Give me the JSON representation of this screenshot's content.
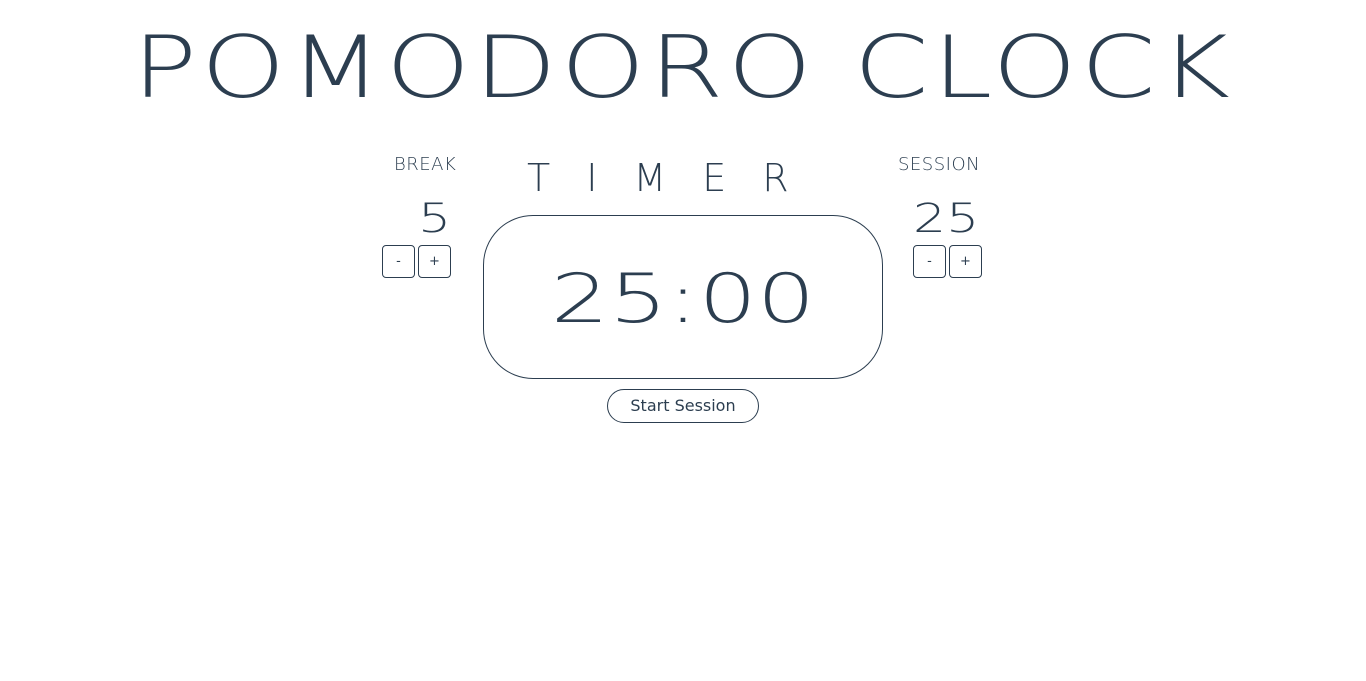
{
  "header": {
    "title": "POMODORO CLOCK"
  },
  "break": {
    "label": "BREAK",
    "value": "5",
    "decrement_label": "-",
    "increment_label": "+"
  },
  "session": {
    "label": "SESSION",
    "value": "25",
    "decrement_label": "-",
    "increment_label": "+"
  },
  "timer": {
    "label": "TIMER",
    "display": "25:00",
    "start_label": "Start Session"
  },
  "colors": {
    "text": "#2c3e50",
    "background": "#ffffff"
  }
}
